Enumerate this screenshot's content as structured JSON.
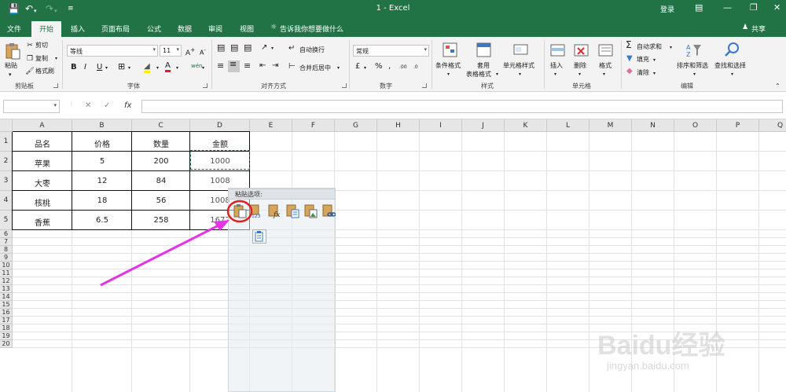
{
  "titlebar": {
    "title": "1  -  Excel",
    "login": "登录"
  },
  "tabs": [
    "文件",
    "开始",
    "插入",
    "页面布局",
    "公式",
    "数据",
    "审阅",
    "视图"
  ],
  "tell_me": "告诉我你想要做什么",
  "share": "共享",
  "ribbon": {
    "clipboard": {
      "paste": "粘贴",
      "cut": "剪切",
      "copy": "复制",
      "format_painter": "格式刷",
      "group": "剪贴板"
    },
    "font": {
      "name": "等线",
      "size": "11",
      "bold": "B",
      "italic": "I",
      "underline": "U",
      "group": "字体"
    },
    "alignment": {
      "wrap": "自动换行",
      "merge": "合并后居中",
      "group": "对齐方式"
    },
    "number": {
      "format": "常规",
      "group": "数字"
    },
    "styles": {
      "conditional": "条件格式",
      "table_line1": "套用",
      "table_line2": "表格格式",
      "cell_styles": "单元格样式",
      "group": "样式"
    },
    "cells": {
      "insert": "插入",
      "delete": "删除",
      "format": "格式",
      "group": "单元格"
    },
    "editing": {
      "autosum": "自动求和",
      "fill": "填充",
      "clear": "清除",
      "sort": "排序和筛选",
      "find": "查找和选择",
      "group": "编辑"
    }
  },
  "formula_bar": {
    "fx": "fx"
  },
  "columns": [
    "A",
    "B",
    "C",
    "D",
    "E",
    "F",
    "G",
    "H",
    "I",
    "J",
    "K",
    "L",
    "M",
    "N",
    "O",
    "P",
    "Q"
  ],
  "rows": [
    "1",
    "2",
    "3",
    "4",
    "5",
    "6",
    "7",
    "8",
    "9",
    "10",
    "11",
    "12",
    "13",
    "14",
    "15",
    "16",
    "17",
    "18",
    "19",
    "20"
  ],
  "table": {
    "headers": [
      "品名",
      "价格",
      "数量",
      "金额"
    ],
    "rows": [
      [
        "苹果",
        "5",
        "200",
        "1000"
      ],
      [
        "大枣",
        "12",
        "84",
        "1008"
      ],
      [
        "核桃",
        "18",
        "56",
        "1008"
      ],
      [
        "香蕉",
        "6.5",
        "258",
        "1677"
      ]
    ]
  },
  "paste_options": {
    "title": "粘贴选项:",
    "icons": [
      "paste-icon",
      "paste-values-icon",
      "paste-formulas-icon",
      "paste-formatting-icon",
      "paste-picture-icon",
      "paste-link-icon"
    ],
    "values_badge": "123"
  },
  "watermark": {
    "text": "Baidu经验",
    "url": "jingyan.baidu.com"
  },
  "colors": {
    "accent": "#217346",
    "arrow": "#e533e5",
    "highlight_ring": "#e02020"
  }
}
